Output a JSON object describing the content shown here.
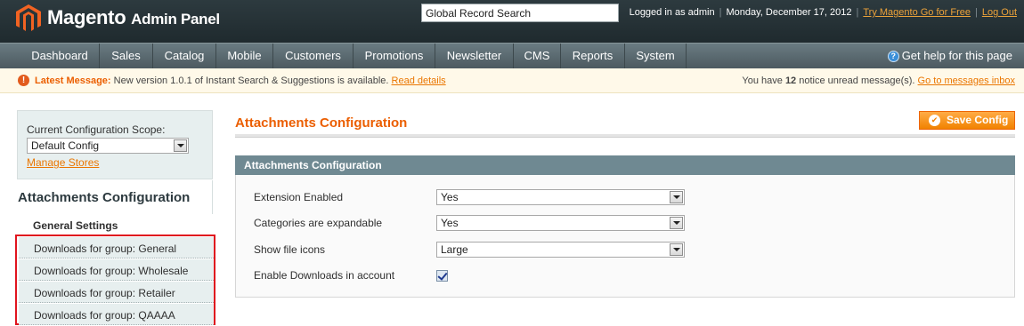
{
  "header": {
    "brand": "Magento",
    "brand_sub": "Admin Panel",
    "search_value": "Global Record Search",
    "logged_in": "Logged in as admin",
    "date": "Monday, December 17, 2012",
    "try_link": "Try Magento Go for Free",
    "logout_link": "Log Out"
  },
  "nav": {
    "items": [
      "Dashboard",
      "Sales",
      "Catalog",
      "Mobile",
      "Customers",
      "Promotions",
      "Newsletter",
      "CMS",
      "Reports",
      "System"
    ],
    "help": "Get help for this page"
  },
  "notice": {
    "label": "Latest Message:",
    "message": "New version 1.0.1 of Instant Search & Suggestions is available.",
    "read_details": "Read details",
    "right_prefix": "You have",
    "count": "12",
    "right_suffix": "notice unread message(s).",
    "inbox_link": "Go to messages inbox"
  },
  "scope": {
    "label": "Current Configuration Scope:",
    "value": "Default Config",
    "manage_stores": "Manage Stores"
  },
  "sidebar": {
    "title": "Attachments Configuration",
    "head": "General Settings",
    "tabs": [
      "Downloads for group: General",
      "Downloads for group: Wholesale",
      "Downloads for group: Retailer",
      "Downloads for group: QAAAA"
    ]
  },
  "main": {
    "title": "Attachments Configuration",
    "save_label": "Save Config",
    "section_title": "Attachments Configuration",
    "fields": [
      {
        "label": "Extension Enabled",
        "value": "Yes"
      },
      {
        "label": "Categories are expandable",
        "value": "Yes"
      },
      {
        "label": "Show file icons",
        "value": "Large"
      },
      {
        "label": "Enable Downloads in account",
        "checked": true
      }
    ]
  },
  "colors": {
    "accent": "#eb5e00",
    "header_bg": "#2d3a3f",
    "nav_bg": "#5b6b71",
    "section_head": "#6f8992",
    "highlight_border": "#e0141e"
  }
}
